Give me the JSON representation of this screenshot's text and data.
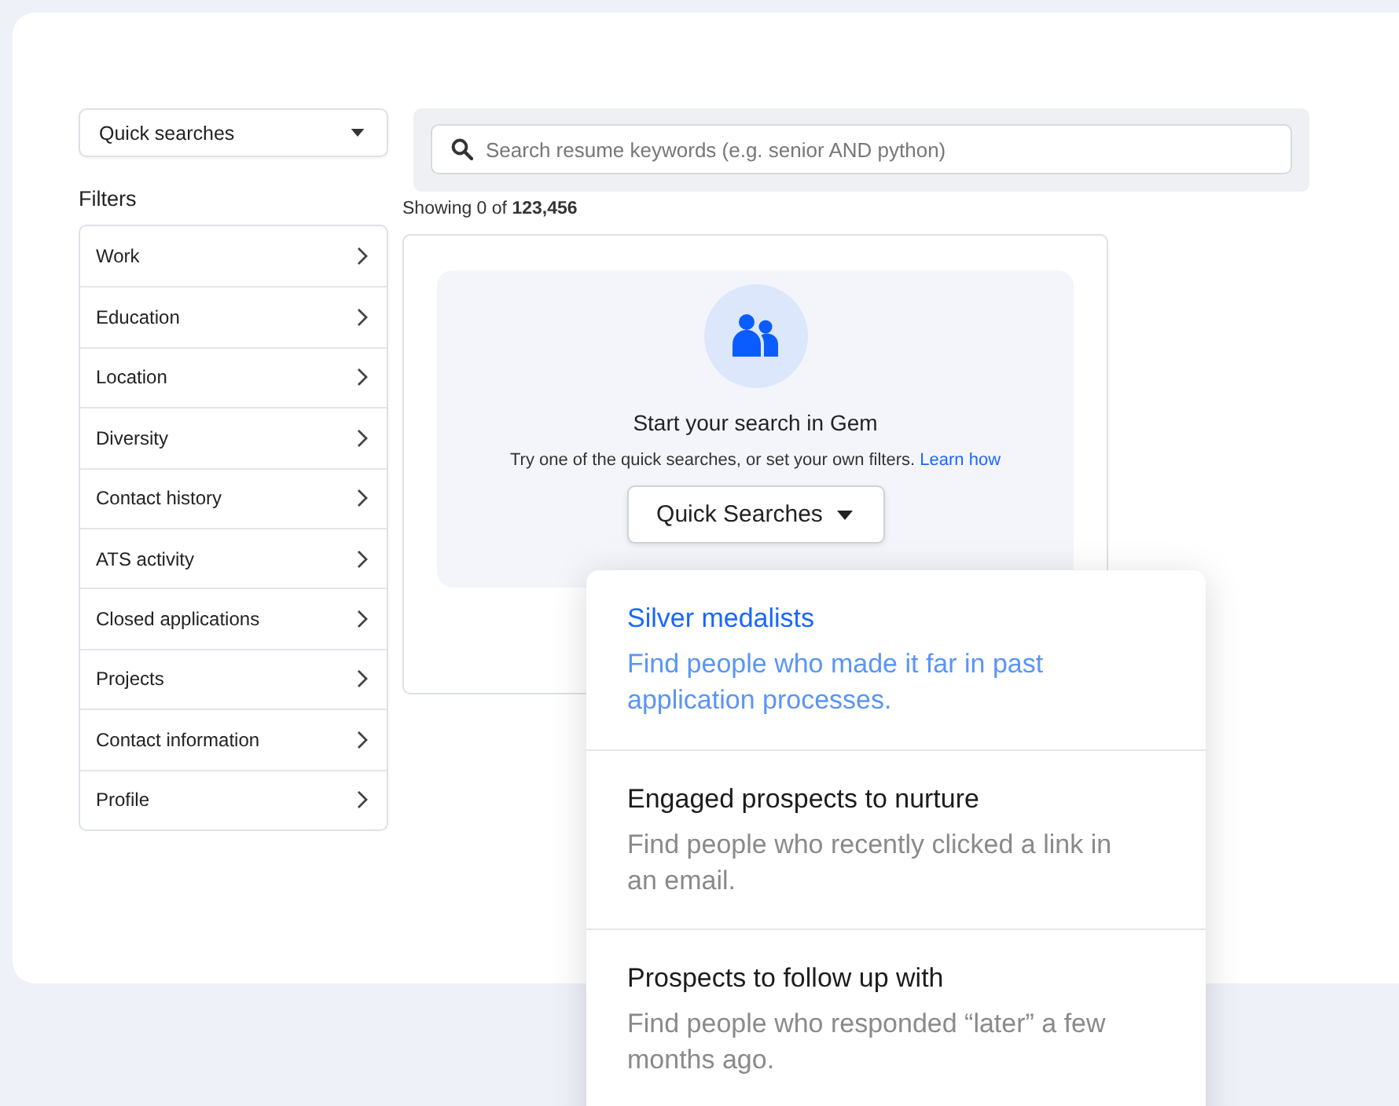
{
  "quick_searches_select": {
    "label": "Quick searches"
  },
  "filters": {
    "title": "Filters",
    "items": [
      "Work",
      "Education",
      "Location",
      "Diversity",
      "Contact history",
      "ATS activity",
      "Closed applications",
      "Projects",
      "Contact information",
      "Profile"
    ]
  },
  "search": {
    "placeholder": "Search resume keywords (e.g. senior AND python)"
  },
  "results": {
    "prefix": "Showing 0 of ",
    "total": "123,456"
  },
  "empty_state": {
    "title": "Start your search in Gem",
    "text": "Try one of the quick searches, or set your own filters.",
    "link": "Learn how",
    "button": "Quick Searches"
  },
  "menu": [
    {
      "title": "Silver medalists",
      "description": "Find people who made it far in past application processes.",
      "selected": true
    },
    {
      "title": "Engaged prospects to nurture",
      "description": "Find people who recently clicked a link in an email.",
      "selected": false
    },
    {
      "title": "Prospects to follow up with",
      "description": "Find people who responded “later” a few months ago.",
      "selected": false
    }
  ]
}
